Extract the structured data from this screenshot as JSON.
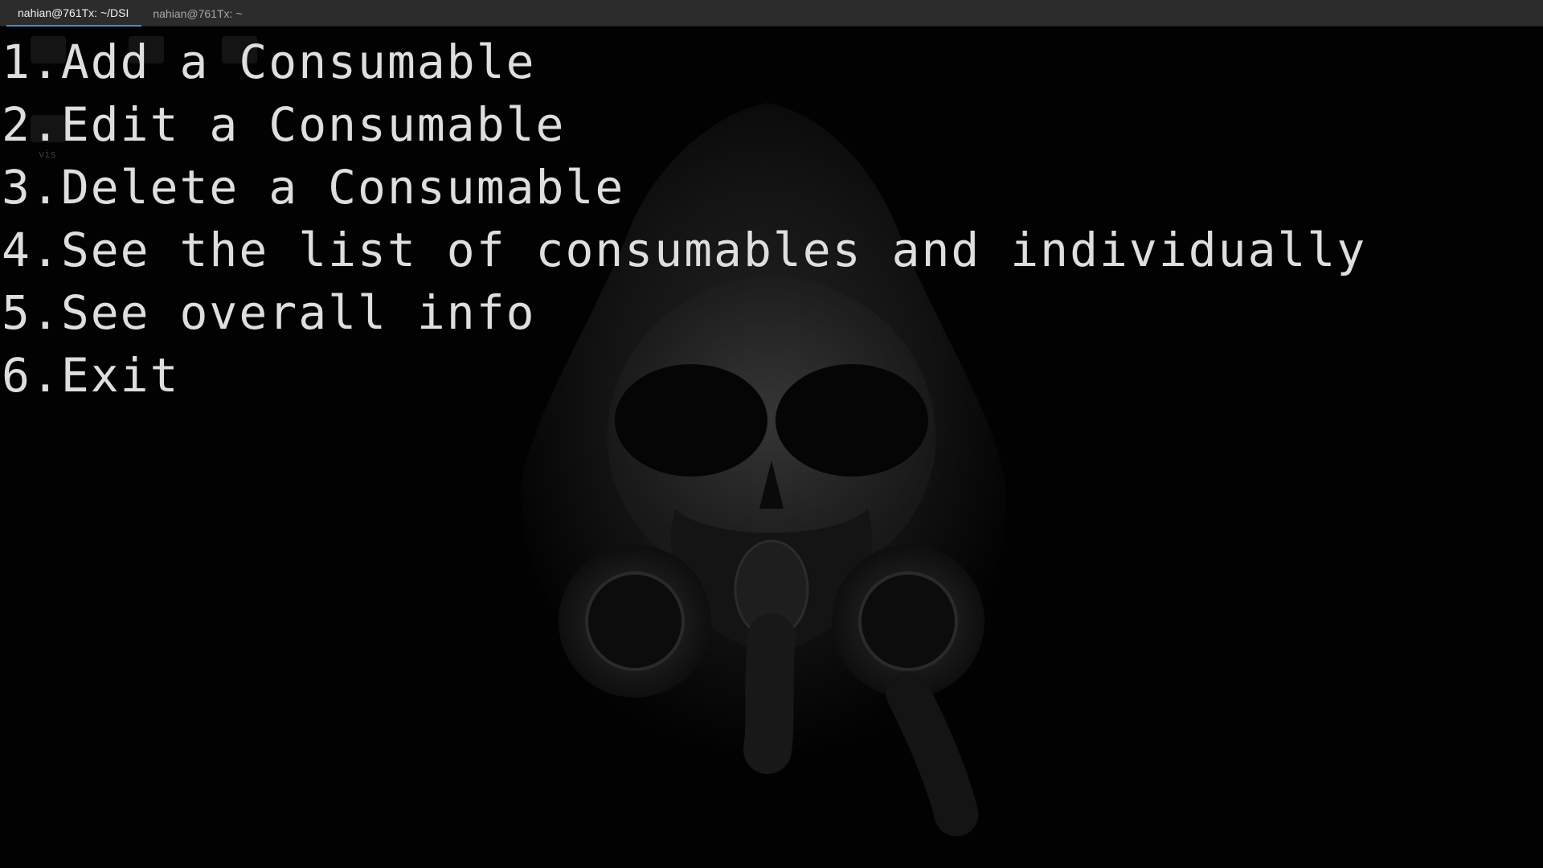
{
  "tabs": [
    {
      "label": "nahian@761Tx: ~/DSI",
      "active": true
    },
    {
      "label": "nahian@761Tx: ~",
      "active": false
    }
  ],
  "desktop": {
    "label": "vis"
  },
  "terminal": {
    "lines": [
      "1.Add a Consumable",
      "2.Edit a Consumable",
      "3.Delete a Consumable",
      "4.See the list of consumables and individually",
      "5.See overall info",
      "6.Exit"
    ]
  },
  "colors": {
    "background": "#020202",
    "tabbar": "#2c2c2c",
    "tab_accent": "#3d8fd6",
    "text": "#dedede"
  }
}
